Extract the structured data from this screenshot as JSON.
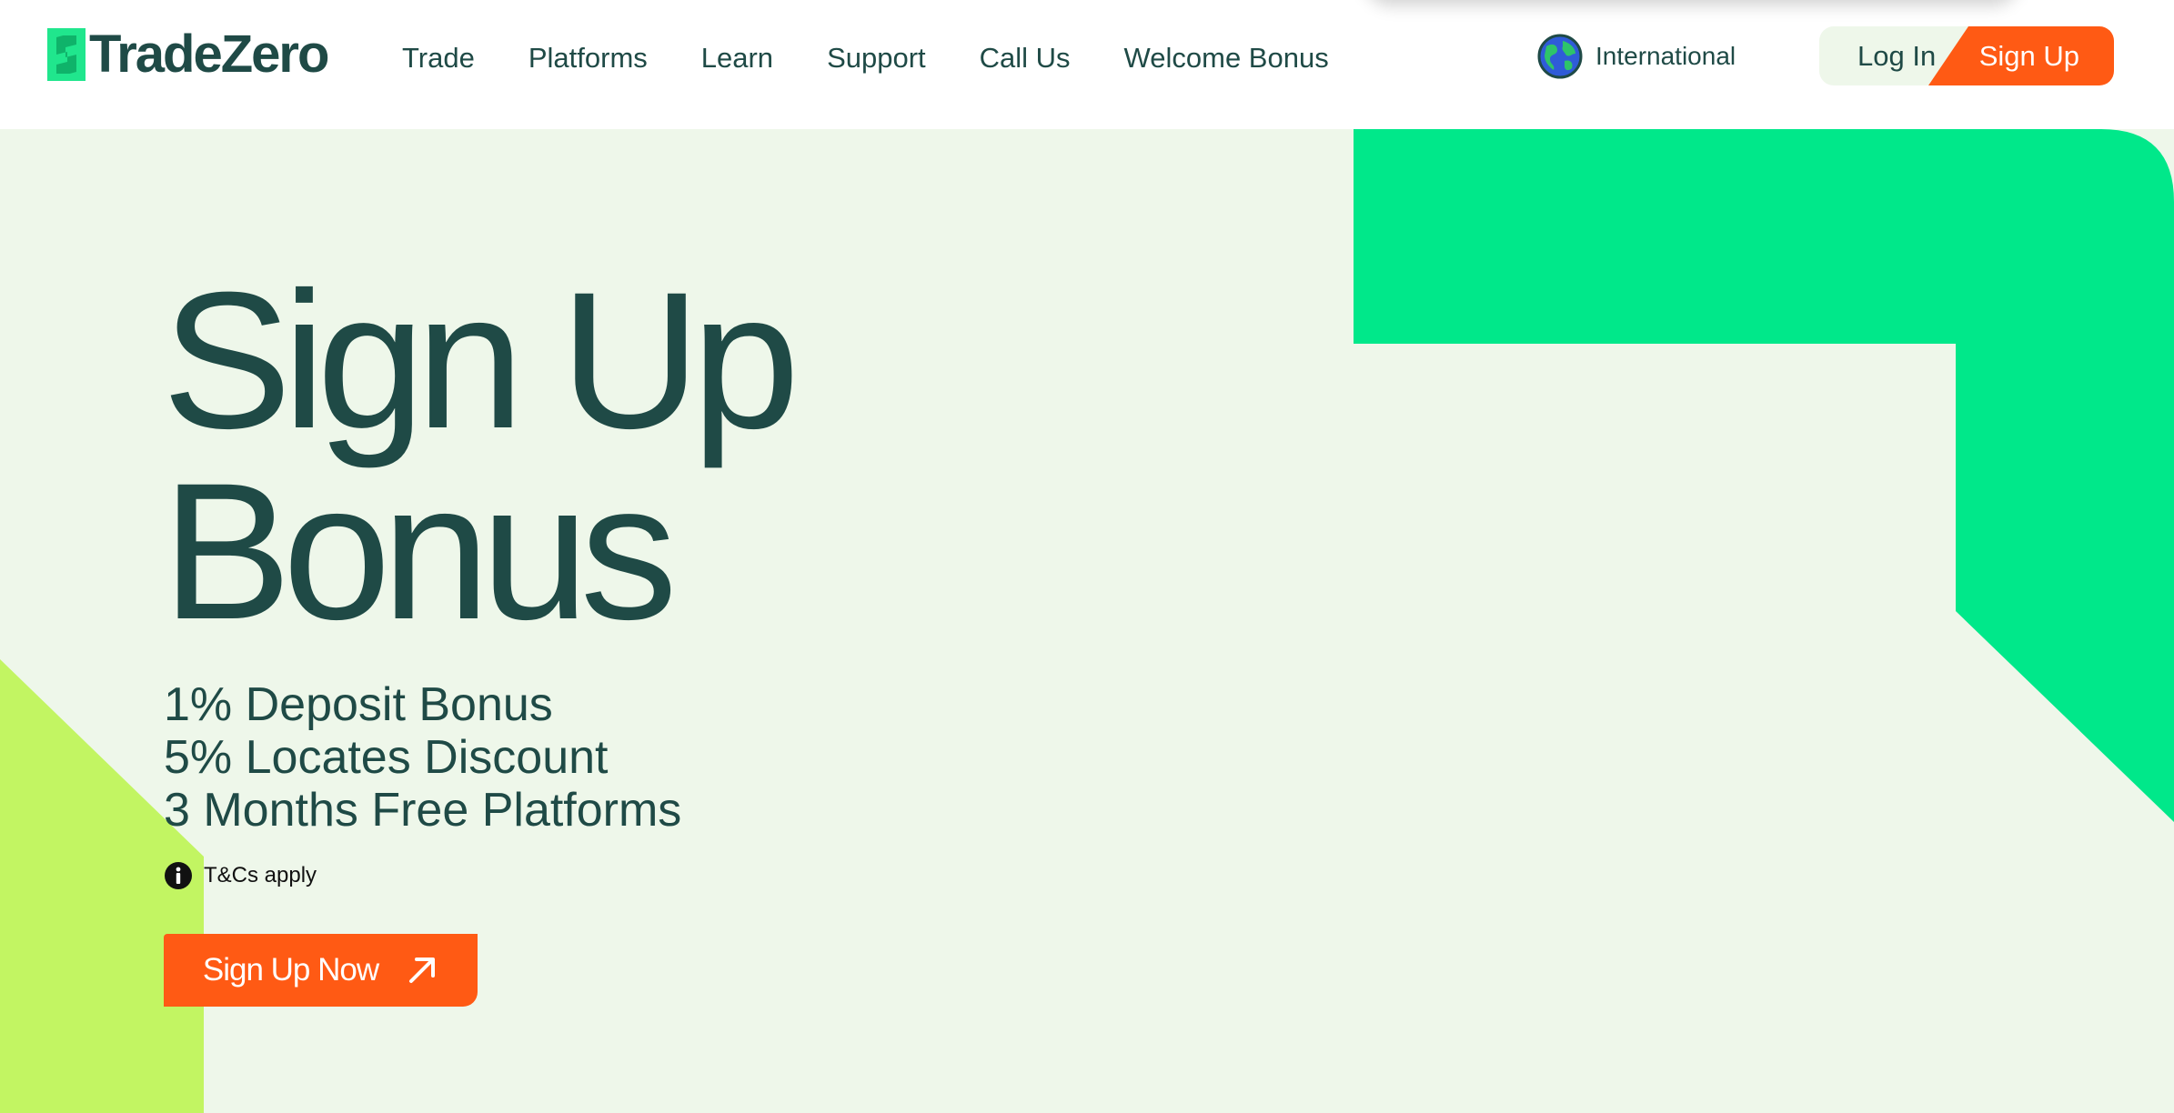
{
  "brand": {
    "name": "TradeZero"
  },
  "nav": {
    "items": [
      {
        "label": "Trade"
      },
      {
        "label": "Platforms"
      },
      {
        "label": "Learn"
      },
      {
        "label": "Support"
      },
      {
        "label": "Call Us"
      },
      {
        "label": "Welcome Bonus"
      }
    ]
  },
  "region": {
    "label": "International",
    "icon": "globe-icon"
  },
  "auth": {
    "login_label": "Log In",
    "signup_label": "Sign Up"
  },
  "hero": {
    "title_line1": "Sign Up",
    "title_line2": "Bonus",
    "perks": [
      "1% Deposit Bonus",
      "5% Locates Discount",
      "3 Months Free Platforms"
    ],
    "terms_label": "T&Cs apply",
    "cta_label": "Sign Up Now"
  },
  "colors": {
    "brand_dark": "#1f4a46",
    "accent_orange": "#ff5a14",
    "bright_green": "#00e88a",
    "lime": "#c2f562",
    "hero_bg": "#eef7ea"
  }
}
